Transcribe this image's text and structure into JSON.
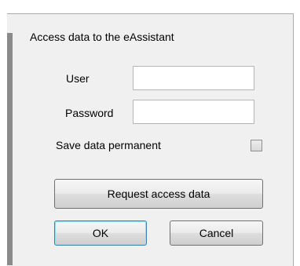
{
  "dialog": {
    "title": "Access data to the eAssistant",
    "user_label": "User",
    "user_value": "",
    "password_label": "Password",
    "password_value": "",
    "save_label": "Save data permanent",
    "save_checked": false,
    "request_button": "Request access data",
    "ok_button": "OK",
    "cancel_button": "Cancel"
  },
  "colors": {
    "frame_border": "#d9a25a",
    "background": "#f0f0f0",
    "default_button_border": "#3c7fb1"
  }
}
